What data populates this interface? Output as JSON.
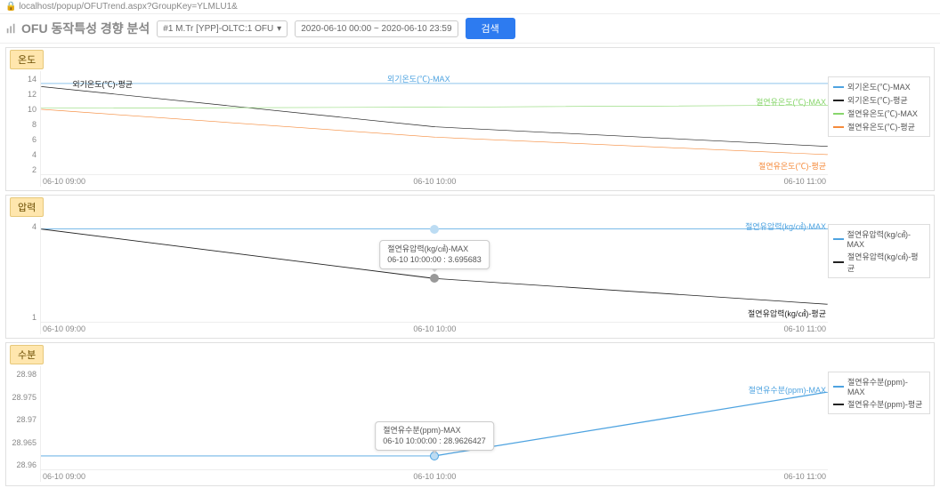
{
  "url": "localhost/popup/OFUTrend.aspx?GroupKey=YLMLU1&",
  "page_title": "OFU 동작특성 경향 분석",
  "controls": {
    "selector_value": "#1 M.Tr [YPP]-OLTC:1 OFU",
    "date_range": "2020-06-10 00:00 ~ 2020-06-10 23:59",
    "search_label": "검색"
  },
  "panels": {
    "temperature": {
      "title": "온도",
      "x_ticks": [
        "06-10 09:00",
        "06-10 10:00",
        "06-10 11:00"
      ],
      "y_ticks": [
        "14",
        "12",
        "10",
        "8",
        "6",
        "4",
        "2"
      ],
      "legend": [
        {
          "label": "외기온도(℃)-MAX",
          "color": "#4ea3e0"
        },
        {
          "label": "외기온도(℃)-평균",
          "color": "#222"
        },
        {
          "label": "절연유온도(℃)-MAX",
          "color": "#88d66c"
        },
        {
          "label": "절연유온도(℃)-평균",
          "color": "#f58b3c"
        }
      ],
      "end_labels": [
        {
          "text": "외기온도(℃)-평균",
          "color": "#222",
          "pos": "left"
        },
        {
          "text": "외기온도(℃)-MAX",
          "color": "#4ea3e0",
          "pos": "mid"
        },
        {
          "text": "절연유온도(℃)-MAX",
          "color": "#88d66c",
          "pos": "right-top"
        },
        {
          "text": "절연유온도(℃)-평균",
          "color": "#f58b3c",
          "pos": "right-bottom"
        }
      ]
    },
    "pressure": {
      "title": "압력",
      "x_ticks": [
        "06-10 09:00",
        "06-10 10:00",
        "06-10 11:00"
      ],
      "y_ticks": [
        "4",
        "1"
      ],
      "legend": [
        {
          "label": "절연유압력(kg/㎠)-MAX",
          "color": "#4ea3e0"
        },
        {
          "label": "절연유압력(kg/㎠)-평균",
          "color": "#222"
        }
      ],
      "end_labels": [
        {
          "text": "절연유압력(kg/㎠)-MAX",
          "color": "#4ea3e0",
          "pos": "right-top"
        },
        {
          "text": "절연유압력(kg/㎠)-평균",
          "color": "#222",
          "pos": "right-bottom"
        }
      ],
      "tooltip": {
        "line1": "절연유압력(kg/㎠)-MAX",
        "line2": "06-10 10:00:00 : 3.695683"
      }
    },
    "moisture": {
      "title": "수분",
      "x_ticks": [
        "06-10 09:00",
        "06-10 10:00",
        "06-10 11:00"
      ],
      "y_ticks": [
        "28.98",
        "28.975",
        "28.97",
        "28.965",
        "28.96"
      ],
      "legend": [
        {
          "label": "절연유수분(ppm)-MAX",
          "color": "#4ea3e0"
        },
        {
          "label": "절연유수분(ppm)-평균",
          "color": "#222"
        }
      ],
      "end_labels": [
        {
          "text": "절연유수분(ppm)-MAX",
          "color": "#4ea3e0",
          "pos": "right"
        }
      ],
      "tooltip": {
        "line1": "절연유수분(ppm)-MAX",
        "line2": "06-10 10:00:00 : 28.9626427"
      }
    }
  },
  "chart_data": [
    {
      "type": "line",
      "title": "온도",
      "xlabel": "",
      "ylabel": "℃",
      "x": [
        "06-10 09:00",
        "06-10 10:00",
        "06-10 11:00"
      ],
      "ylim": [
        2,
        14
      ],
      "series": [
        {
          "name": "외기온도(℃)-MAX",
          "values": [
            12.6,
            12.6,
            12.6
          ]
        },
        {
          "name": "외기온도(℃)-평균",
          "values": [
            12.0,
            7.5,
            5.2
          ]
        },
        {
          "name": "절연유온도(℃)-MAX",
          "values": [
            9.7,
            9.8,
            10.0
          ]
        },
        {
          "name": "절연유온도(℃)-평균",
          "values": [
            9.5,
            6.3,
            4.3
          ]
        }
      ]
    },
    {
      "type": "line",
      "title": "압력",
      "xlabel": "",
      "ylabel": "kg/㎠",
      "x": [
        "06-10 09:00",
        "06-10 10:00",
        "06-10 11:00"
      ],
      "ylim": [
        1,
        4
      ],
      "series": [
        {
          "name": "절연유압력(kg/㎠)-MAX",
          "values": [
            3.7,
            3.7,
            3.7
          ]
        },
        {
          "name": "절연유압력(kg/㎠)-평균",
          "values": [
            3.7,
            2.25,
            1.5
          ]
        }
      ]
    },
    {
      "type": "line",
      "title": "수분",
      "xlabel": "",
      "ylabel": "ppm",
      "x": [
        "06-10 09:00",
        "06-10 10:00",
        "06-10 11:00"
      ],
      "ylim": [
        28.96,
        28.98
      ],
      "series": [
        {
          "name": "절연유수분(ppm)-MAX",
          "values": [
            28.9626,
            28.9626,
            28.9752
          ]
        },
        {
          "name": "절연유수분(ppm)-평균",
          "values": [
            28.9626,
            28.9626,
            28.9752
          ]
        }
      ]
    }
  ]
}
